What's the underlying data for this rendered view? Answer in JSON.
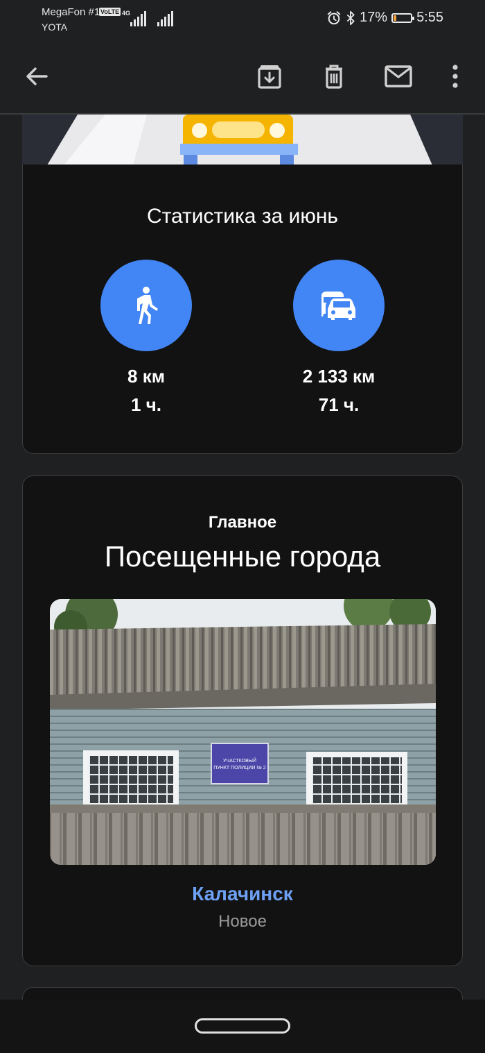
{
  "status_bar": {
    "carrier_primary": "MegaFon #1",
    "carrier_secondary": "YOTA",
    "volte": "VoLTE",
    "network": "4G",
    "battery_percent": "17%",
    "battery_level": 0.17,
    "time": "5:55",
    "icons": [
      "signal-icon",
      "alarm-icon",
      "bluetooth-icon",
      "battery-icon"
    ]
  },
  "app_bar": {
    "icons": [
      "back-arrow-icon",
      "archive-icon",
      "delete-icon",
      "mark-unread-icon",
      "more-vert-icon"
    ]
  },
  "stats": {
    "title": "Статистика за июнь",
    "walking": {
      "icon": "walking-icon",
      "distance": "8 км",
      "time": "1 ч."
    },
    "driving": {
      "icon": "transit-car-icon",
      "distance": "2 133 км",
      "time": "71 ч."
    }
  },
  "highlights": {
    "label": "Главное",
    "title": "Посещенные города",
    "photo": {
      "sign_line1": "УЧАСТКОВЫЙ",
      "sign_line2": "ПУНКТ ПОЛИЦИИ № 2"
    },
    "city_name": "Калачинск",
    "city_status": "Новое"
  },
  "colors": {
    "accent_blue": "#4285f4",
    "link_blue": "#6ea0f4",
    "card_bg": "#121212",
    "page_bg": "#1f2022"
  }
}
